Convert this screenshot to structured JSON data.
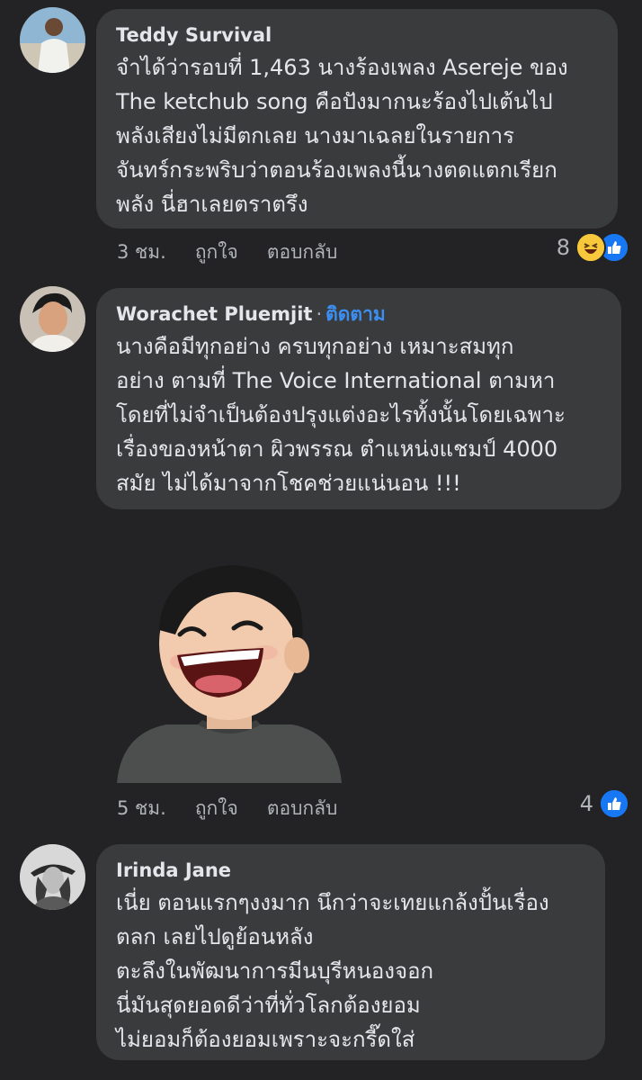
{
  "comments": [
    {
      "author": "Teddy Survival",
      "follow_label": "",
      "text": "จำได้ว่ารอบที่ 1,463 นางร้องเพลง Asereje ของ\nThe ketchub song  คือปังมากนะร้องไปเต้นไป\nพลังเสียงไม่มีตกเลย นางมาเฉลยในรายการ\nจันทร์กระพริบว่าตอนร้องเพลงนี้นางตดแตกเรียก\nพลัง นี่ฮาเลยตราตรึง",
      "time": "3 ชม.",
      "like_label": "ถูกใจ",
      "reply_label": "ตอบกลับ",
      "reaction_count": "8",
      "reactions": [
        "haha-icon",
        "like-icon"
      ]
    },
    {
      "author": "Worachet Pluemjit",
      "dot": "·",
      "follow_label": "ติดตาม",
      "text": "นางคือมีทุกอย่าง ครบทุกอย่าง เหมาะสมทุก\nอย่าง ตามที่ The Voice International ตามหา\nโดยที่ไม่จำเป็นต้องปรุงแต่งอะไรทั้งนั้นโดยเฉพาะ\nเรื่องของหน้าตา ผิวพรรณ ตำแหน่งแชมป์ 4000\nสมัย ไม่ได้มาจากโชคช่วยแน่นอน !!!",
      "sticker": "laughing-avatar-sticker",
      "time": "5 ชม.",
      "like_label": "ถูกใจ",
      "reply_label": "ตอบกลับ",
      "reaction_count": "4",
      "reactions": [
        "like-icon"
      ]
    },
    {
      "author": "Irinda Jane",
      "follow_label": "",
      "text": "เนี่ย ตอนแรกๆงงมาก นึกว่าจะเทยแกล้งปั้นเรื่อง\nตลก เลยไปดูย้อนหลัง\nตะลึงในพัฒนาการมีนบุรีหนองจอก\nนี่มันสุดยอดดีว่าที่ทั่วโลกต้องยอม\nไม่ยอมก็ต้องยอมเพราะจะกรี๊ดใส่"
    }
  ],
  "colors": {
    "background": "#232325",
    "bubble": "#3a3b3c",
    "text": "#e4e6eb",
    "muted": "#b0b3b8",
    "link": "#3d8ef2",
    "like_blue": "#1877f2",
    "haha_yellow": "#f7c73c"
  }
}
